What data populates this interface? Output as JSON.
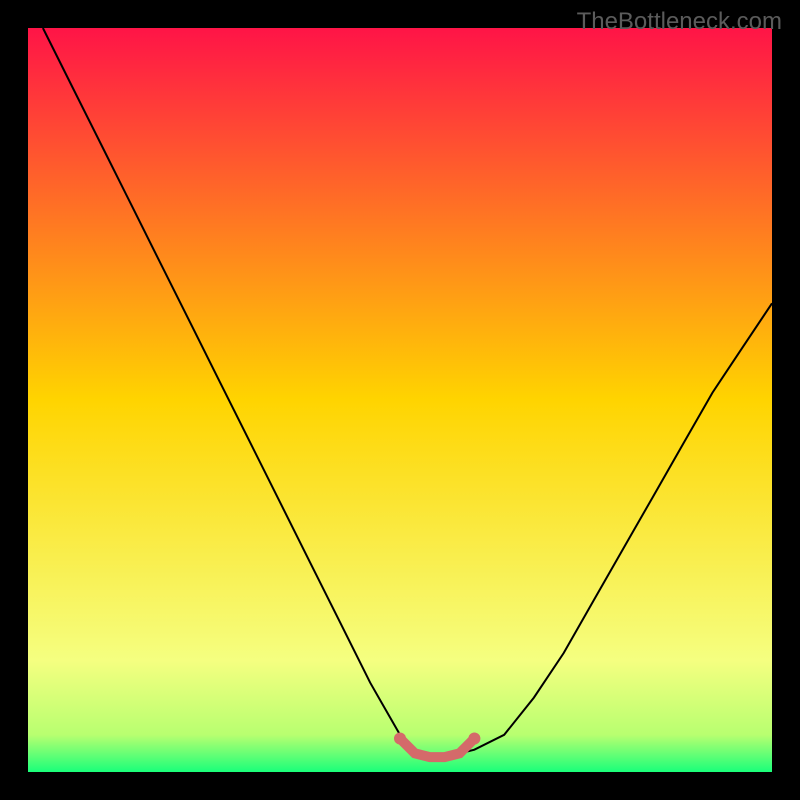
{
  "watermark": "TheBottleneck.com",
  "chart_data": {
    "type": "line",
    "title": "",
    "xlabel": "",
    "ylabel": "",
    "xlim": [
      0,
      100
    ],
    "ylim": [
      0,
      100
    ],
    "background_gradient": {
      "stops": [
        {
          "offset": 0,
          "color": "#ff1447"
        },
        {
          "offset": 50,
          "color": "#ffd400"
        },
        {
          "offset": 85,
          "color": "#f5ff80"
        },
        {
          "offset": 95,
          "color": "#b8ff70"
        },
        {
          "offset": 100,
          "color": "#1aff7a"
        }
      ]
    },
    "series": [
      {
        "name": "curve",
        "color": "#000000",
        "x": [
          2,
          6,
          10,
          14,
          18,
          22,
          26,
          30,
          34,
          38,
          42,
          46,
          50,
          52,
          54,
          56,
          60,
          64,
          68,
          72,
          76,
          80,
          84,
          88,
          92,
          96,
          100
        ],
        "y": [
          100,
          92,
          84,
          76,
          68,
          60,
          52,
          44,
          36,
          28,
          20,
          12,
          5,
          3,
          2,
          2,
          3,
          5,
          10,
          16,
          23,
          30,
          37,
          44,
          51,
          57,
          63
        ]
      },
      {
        "name": "optimal-band",
        "color": "#d46a6a",
        "style": "thick",
        "x": [
          50,
          52,
          54,
          56,
          58,
          60
        ],
        "y": [
          4.5,
          2.5,
          2,
          2,
          2.5,
          4.5
        ]
      }
    ],
    "markers": [
      {
        "name": "optimal-start",
        "x": 50,
        "y": 4.5,
        "color": "#d46a6a"
      },
      {
        "name": "optimal-end",
        "x": 60,
        "y": 4.5,
        "color": "#d46a6a"
      }
    ]
  }
}
